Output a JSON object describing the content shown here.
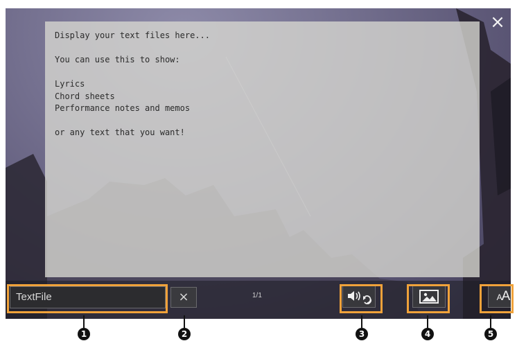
{
  "window": {
    "close_icon": "close-icon"
  },
  "text_panel": {
    "content": "Display your text files here...\n\nYou can use this to show:\n\nLyrics\nChord sheets\nPerformance notes and memos\n\nor any text that you want!"
  },
  "bottom_bar": {
    "file_name": "TextFile",
    "clear_label": "×",
    "page_indicator": "1/1",
    "audio_link_icon": "speaker-repeat-icon",
    "background_image_icon": "image-icon",
    "font_size_icon": "font-size-icon",
    "font_size_label": "AA"
  },
  "callouts": [
    "1",
    "2",
    "3",
    "4",
    "5"
  ],
  "colors": {
    "highlight": "#f0a23a",
    "panel": "#d6d6d0"
  }
}
